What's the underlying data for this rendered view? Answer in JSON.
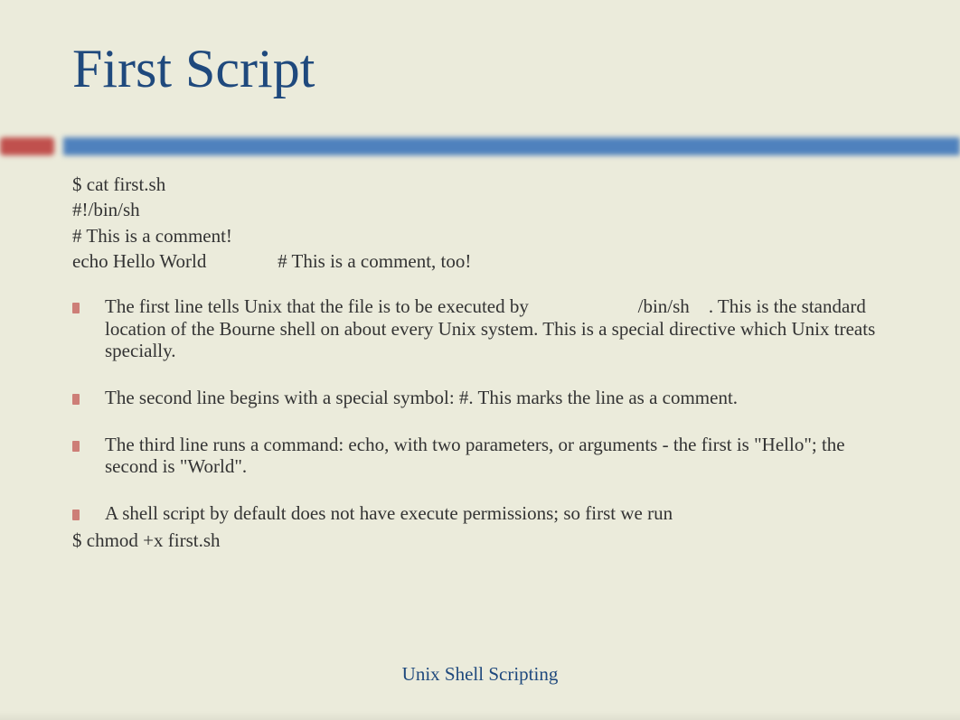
{
  "title": "First Script",
  "code": {
    "line1": "$ cat first.sh",
    "line2": "#!/bin/sh",
    "line3": "# This is a comment!",
    "line4": "echo Hello World               # This is a comment, too!"
  },
  "bullets": {
    "b1_part1": "The first line tells Unix that the file is to be executed by ",
    "b1_path": "                      /bin/sh    ",
    "b1_part2": ". This is the standard location of the Bourne shell on about every Unix system. This is a special directive which Unix treats specially.",
    "b2": "The second line begins with a special symbol: #. This marks the line as a comment.",
    "b3": "The third line runs a command: echo, with two parameters, or arguments - the first is \"Hello\"; the second is \"World\".",
    "b4": "A shell script by default does not have execute permissions; so first we run"
  },
  "chmod_line": "$ chmod +x first.sh",
  "footer": "Unix Shell Scripting"
}
